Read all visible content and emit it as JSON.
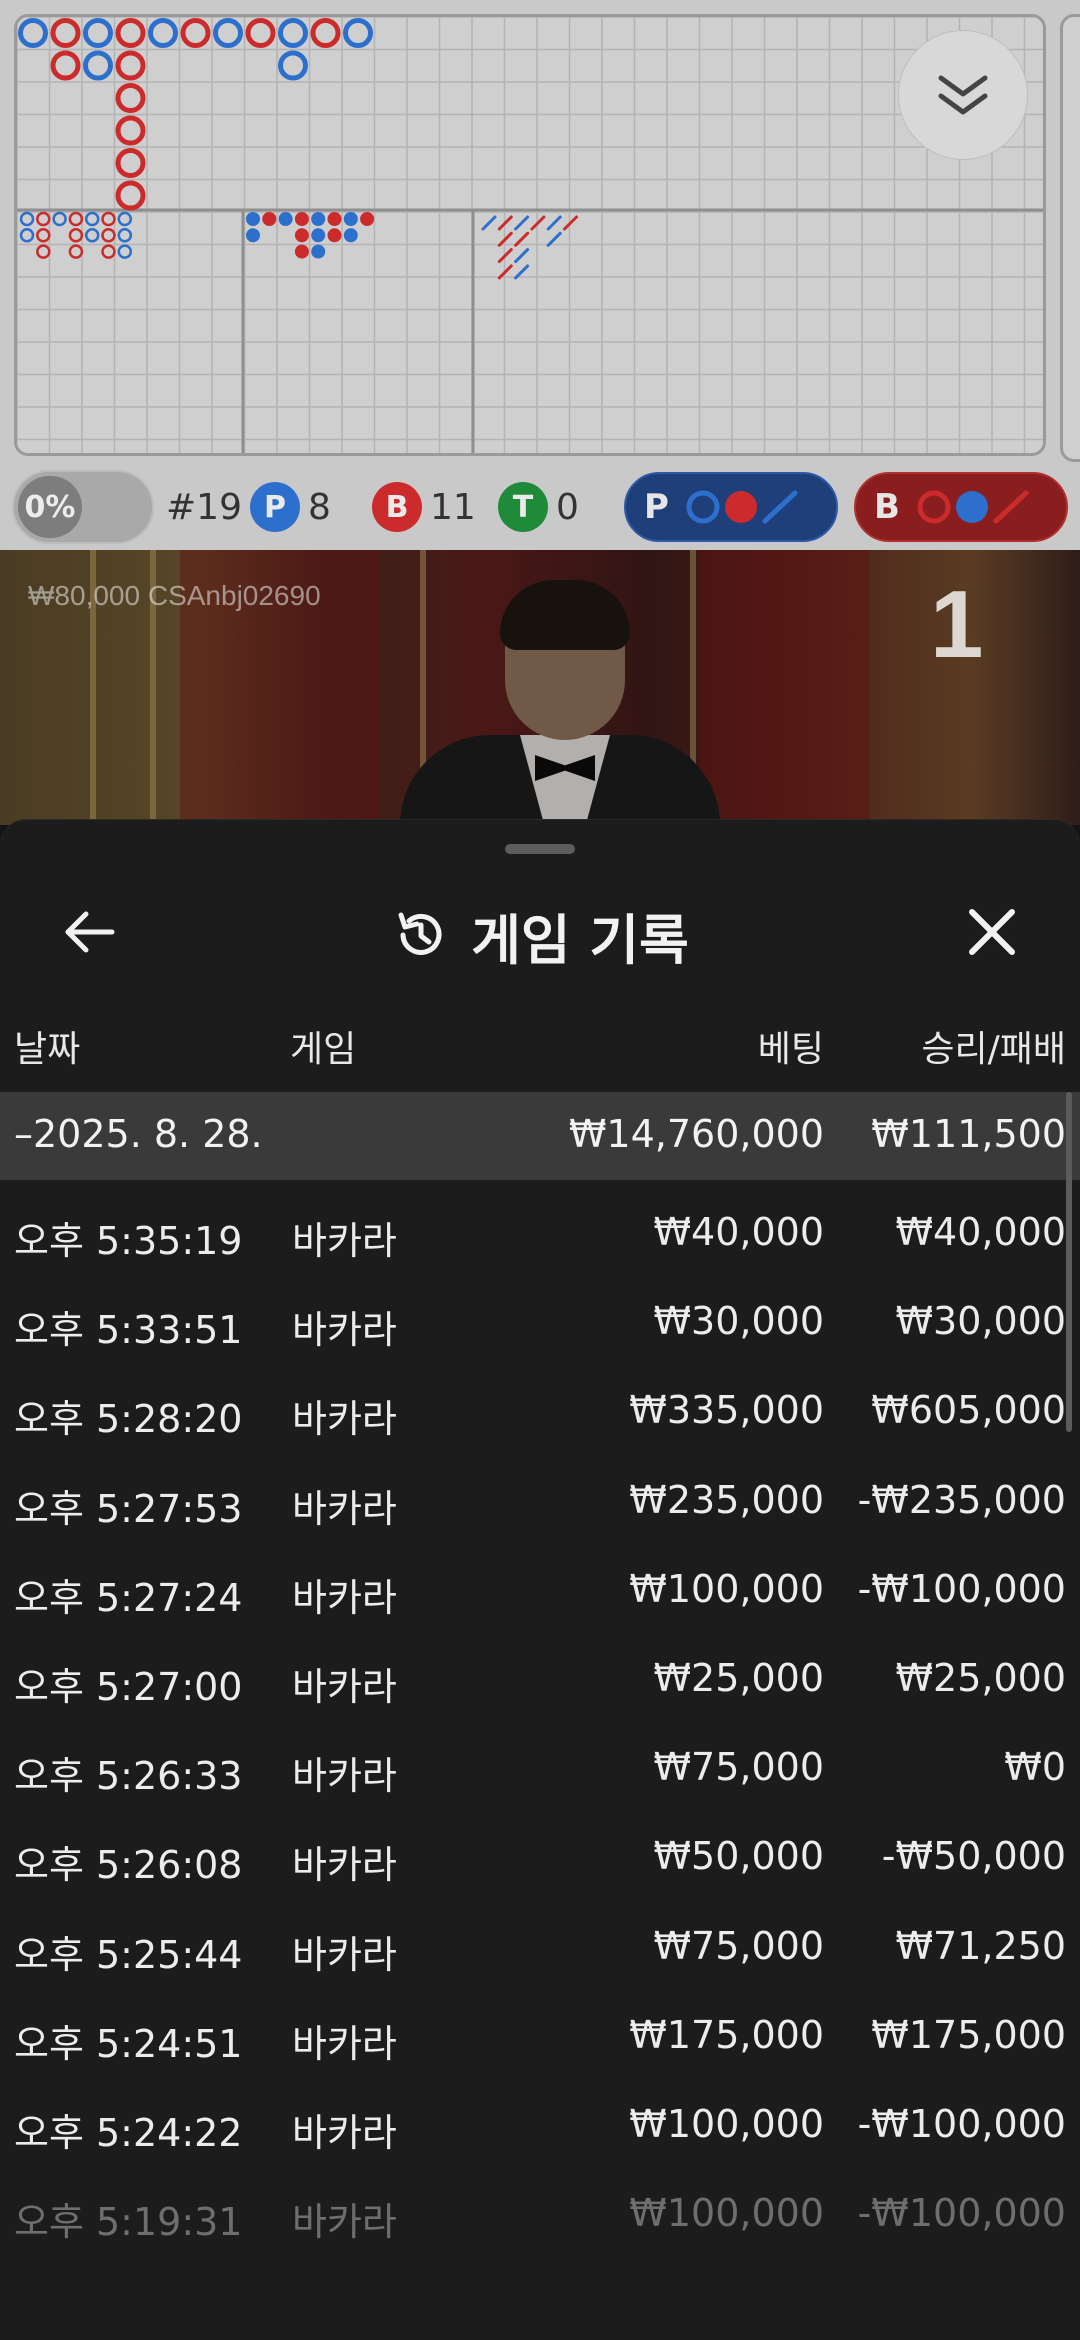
{
  "roadmap": {
    "toggle_label": "0%",
    "round_label": "#19",
    "player_badge": "P",
    "player_count": "8",
    "banker_badge": "B",
    "banker_count": "11",
    "tie_badge": "T",
    "tie_count": "0",
    "player_predict_label": "P",
    "banker_predict_label": "B",
    "colors": {
      "player": "#2d6fcc",
      "banker": "#cc2b2b",
      "tie": "#1f8a3a"
    }
  },
  "video": {
    "player_tag": "₩80,000 CSAnbj02690",
    "round_number": "1"
  },
  "sheet": {
    "title": "게임 기록",
    "columns": {
      "date": "날짜",
      "game": "게임",
      "bet": "베팅",
      "win_loss": "승리/패배"
    },
    "date_group": {
      "date": "–2025. 8. 28.",
      "bet": "₩14,760,000",
      "win_loss": "₩111,500"
    },
    "rows": [
      {
        "time": "오후 5:35:19",
        "game": "바카라",
        "bet": "₩40,000",
        "win_loss": "₩40,000"
      },
      {
        "time": "오후 5:33:51",
        "game": "바카라",
        "bet": "₩30,000",
        "win_loss": "₩30,000"
      },
      {
        "time": "오후 5:28:20",
        "game": "바카라",
        "bet": "₩335,000",
        "win_loss": "₩605,000"
      },
      {
        "time": "오후 5:27:53",
        "game": "바카라",
        "bet": "₩235,000",
        "win_loss": "-₩235,000"
      },
      {
        "time": "오후 5:27:24",
        "game": "바카라",
        "bet": "₩100,000",
        "win_loss": "-₩100,000"
      },
      {
        "time": "오후 5:27:00",
        "game": "바카라",
        "bet": "₩25,000",
        "win_loss": "₩25,000"
      },
      {
        "time": "오후 5:26:33",
        "game": "바카라",
        "bet": "₩75,000",
        "win_loss": "₩0"
      },
      {
        "time": "오후 5:26:08",
        "game": "바카라",
        "bet": "₩50,000",
        "win_loss": "-₩50,000"
      },
      {
        "time": "오후 5:25:44",
        "game": "바카라",
        "bet": "₩75,000",
        "win_loss": "₩71,250"
      },
      {
        "time": "오후 5:24:51",
        "game": "바카라",
        "bet": "₩175,000",
        "win_loss": "₩175,000"
      },
      {
        "time": "오후 5:24:22",
        "game": "바카라",
        "bet": "₩100,000",
        "win_loss": "-₩100,000"
      },
      {
        "time": "오후 5:19:31",
        "game": "바카라",
        "bet": "₩100,000",
        "win_loss": "-₩100,000"
      }
    ]
  }
}
